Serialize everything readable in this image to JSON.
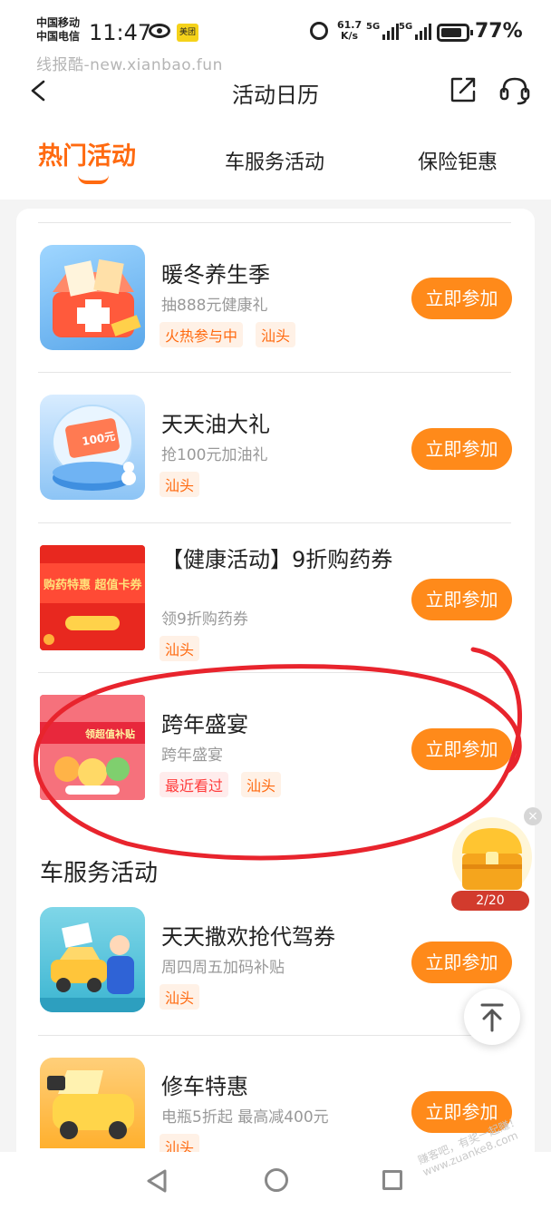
{
  "status_bar": {
    "carrier_1": "中国移动",
    "carrier_2": "中国电信",
    "time": "11:47",
    "app_badge": "美团",
    "net_speed_value": "61.7",
    "net_speed_unit": "K/s",
    "signal_1": "5G",
    "signal_2": "5G",
    "battery": "77%"
  },
  "watermark": "线报酷-new.xianbao.fun",
  "header": {
    "title": "活动日历"
  },
  "tabs": [
    {
      "label": "热门活动",
      "active": true
    },
    {
      "label": "车服务活动",
      "active": false
    },
    {
      "label": "保险钜惠",
      "active": false
    }
  ],
  "hot_activities": [
    {
      "title": "暖冬养生季",
      "subtitle": "抽888元健康礼",
      "tags": [
        "火热参与中",
        "汕头"
      ],
      "button": "立即参加",
      "thumb_icon": "medicine-box-icon"
    },
    {
      "title": "天天油大礼",
      "subtitle": "抢100元加油礼",
      "tags": [
        "汕头"
      ],
      "button": "立即参加",
      "thumb_icon": "fuel-ticket-globe-icon",
      "thumb_text": "100元"
    },
    {
      "title": "【健康活动】9折购药券",
      "subtitle": "领9折购药券",
      "tags": [
        "汕头"
      ],
      "button": "立即参加",
      "thumb_icon": "drug-coupon-banner",
      "thumb_text": "购药特惠 超值卡券"
    },
    {
      "title": "跨年盛宴",
      "subtitle": "跨年盛宴",
      "tags": [
        "最近看过",
        "汕头"
      ],
      "button": "立即参加",
      "thumb_icon": "new-year-banner",
      "thumb_text": "领超值补贴"
    }
  ],
  "car_section": {
    "heading": "车服务活动",
    "items": [
      {
        "title": "天天撒欢抢代驾券",
        "subtitle": "周四周五加码补贴",
        "tags": [
          "汕头"
        ],
        "button": "立即参加",
        "thumb_icon": "chauffeur-car-icon"
      },
      {
        "title": "修车特惠",
        "subtitle": "电瓶5折起 最高减400元",
        "tags": [
          "汕头"
        ],
        "button": "立即参加",
        "thumb_icon": "car-repair-icon"
      }
    ]
  },
  "floating": {
    "treasure_count": "2/20",
    "close": "×"
  },
  "site_stamp": {
    "line1": "赚客吧，有奖一起赚！",
    "line2": "www.zuanke8.com"
  },
  "colors": {
    "accent": "#ff6a10",
    "button": "#ff8a1a",
    "annotation": "#e8242d"
  }
}
